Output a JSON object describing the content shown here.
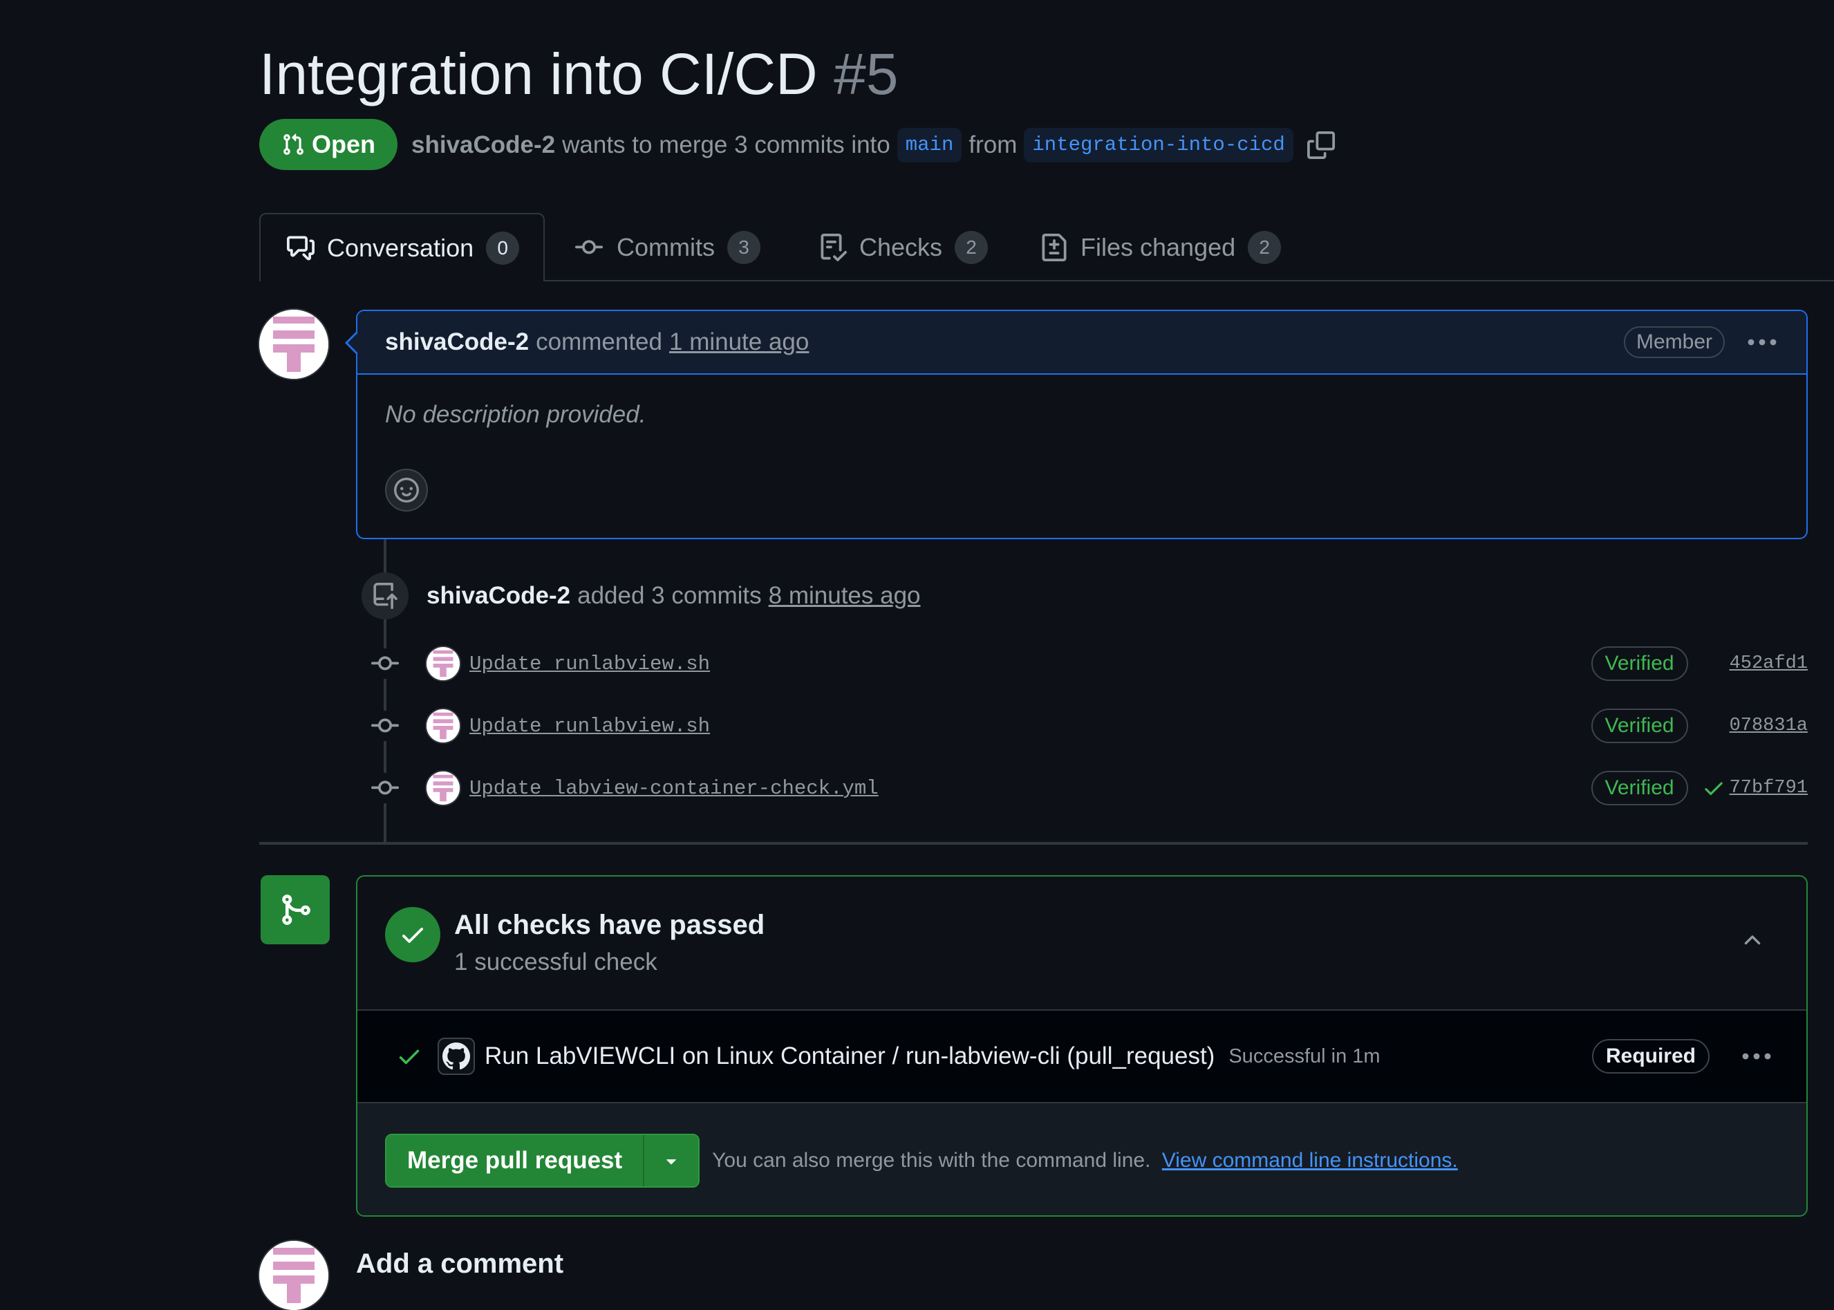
{
  "pr": {
    "title": "Integration into CI/CD",
    "number": "#5",
    "state": "Open",
    "author": "shivaCode-2",
    "merge_text": "wants to merge 3 commits into",
    "base_branch": "main",
    "from_text": "from",
    "head_branch": "integration-into-cicd"
  },
  "tabs": [
    {
      "label": "Conversation",
      "count": "0"
    },
    {
      "label": "Commits",
      "count": "3"
    },
    {
      "label": "Checks",
      "count": "2"
    },
    {
      "label": "Files changed",
      "count": "2"
    }
  ],
  "comment": {
    "author": "shivaCode-2",
    "action": "commented",
    "time": "1 minute ago",
    "badge": "Member",
    "body": "No description provided."
  },
  "push_event": {
    "author": "shivaCode-2",
    "action": "added 3 commits",
    "time": "8 minutes ago"
  },
  "commits": [
    {
      "message": "Update runlabview.sh",
      "verified": "Verified",
      "sha": "452afd1",
      "check": false
    },
    {
      "message": "Update runlabview.sh",
      "verified": "Verified",
      "sha": "078831a",
      "check": false
    },
    {
      "message": "Update labview-container-check.yml",
      "verified": "Verified",
      "sha": "77bf791",
      "check": true
    }
  ],
  "merge_box": {
    "checks_title": "All checks have passed",
    "checks_subtitle": "1 successful check",
    "check": {
      "name": "Run LabVIEWCLI on Linux Container / run-labview-cli (pull_request)",
      "status": "Successful in 1m",
      "badge": "Required"
    },
    "merge_button": "Merge pull request",
    "hint": "You can also merge this with the command line.",
    "hint_link": "View command line instructions."
  },
  "add_comment": {
    "title": "Add a comment"
  },
  "colors": {
    "background": "#0d1117",
    "accent_green": "#238636",
    "link_blue": "#4493f8",
    "muted": "#9198a1"
  }
}
